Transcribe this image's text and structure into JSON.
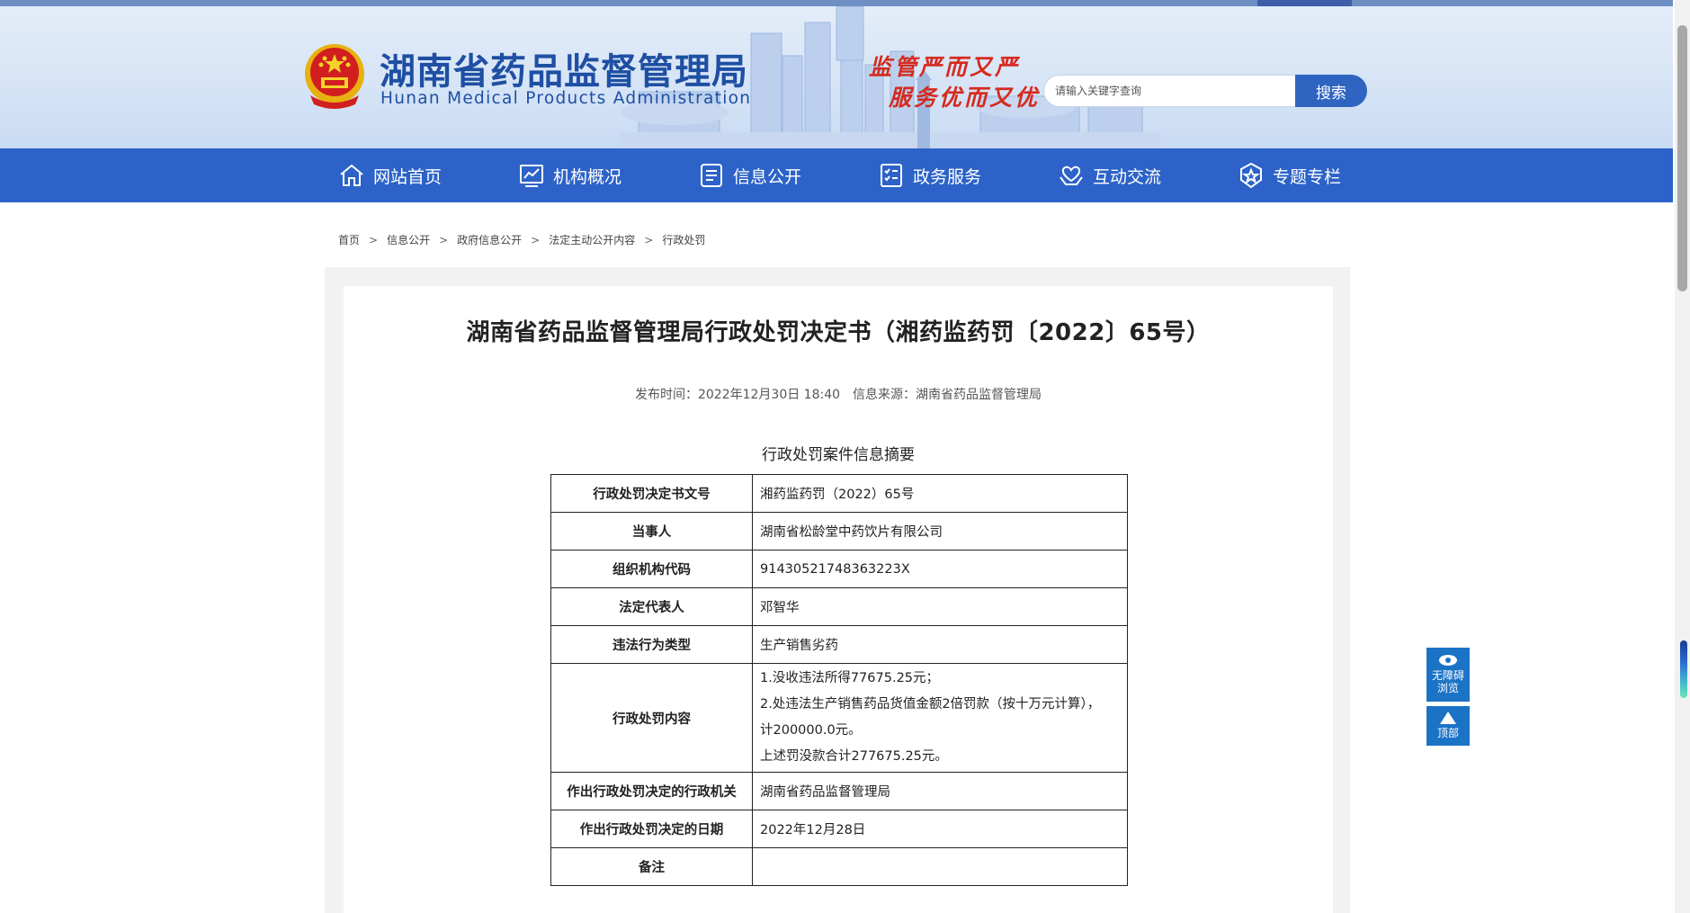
{
  "header": {
    "title": "湖南省药品监督管理局",
    "subtitle": "Hunan Medical Products Administration",
    "slogan_line1": "监管严而又严",
    "slogan_line2": "服务优而又优",
    "search_placeholder": "请输入关键字查询",
    "search_button": "搜索"
  },
  "nav": {
    "items": [
      {
        "label": "网站首页",
        "icon": "home-icon"
      },
      {
        "label": "机构概况",
        "icon": "chart-icon"
      },
      {
        "label": "信息公开",
        "icon": "document-icon"
      },
      {
        "label": "政务服务",
        "icon": "checklist-icon"
      },
      {
        "label": "互动交流",
        "icon": "heart-hands-icon"
      },
      {
        "label": "专题专栏",
        "icon": "star-badge-icon"
      }
    ]
  },
  "breadcrumb": [
    "首页",
    "信息公开",
    "政府信息公开",
    "法定主动公开内容",
    "行政处罚"
  ],
  "article": {
    "title": "湖南省药品监督管理局行政处罚决定书（湘药监药罚〔2022〕65号）",
    "publish_time": "发布时间：2022年12月30日 18:40",
    "source": "信息来源：湖南省药品监督管理局",
    "table_caption": "行政处罚案件信息摘要",
    "table": [
      {
        "key": "行政处罚决定书文号",
        "value": [
          "湘药监药罚（2022）65号"
        ]
      },
      {
        "key": "当事人",
        "value": [
          "湖南省松龄堂中药饮片有限公司"
        ]
      },
      {
        "key": "组织机构代码",
        "value": [
          "91430521748363223X"
        ]
      },
      {
        "key": "法定代表人",
        "value": [
          "邓智华"
        ]
      },
      {
        "key": "违法行为类型",
        "value": [
          "生产销售劣药"
        ]
      },
      {
        "key": "行政处罚内容",
        "value": [
          "1.没收违法所得77675.25元；",
          "2.处违法生产销售药品货值金额2倍罚款（按十万元计算），",
          "计200000.0元。",
          "上述罚没款合计277675.25元。"
        ]
      },
      {
        "key": "作出行政处罚决定的行政机关",
        "value": [
          "湖南省药品监督管理局"
        ]
      },
      {
        "key": "作出行政处罚决定的日期",
        "value": [
          "2022年12月28日"
        ]
      },
      {
        "key": "备注",
        "value": [
          ""
        ]
      }
    ]
  },
  "float_tools": {
    "accessible_line1": "无障碍",
    "accessible_line2": "浏览",
    "top": "顶部"
  },
  "colors": {
    "nav_blue": "#2d63c8",
    "title_blue": "#1e4fa3",
    "slogan_red": "#d62a1f",
    "float_blue": "#1b73c6"
  }
}
